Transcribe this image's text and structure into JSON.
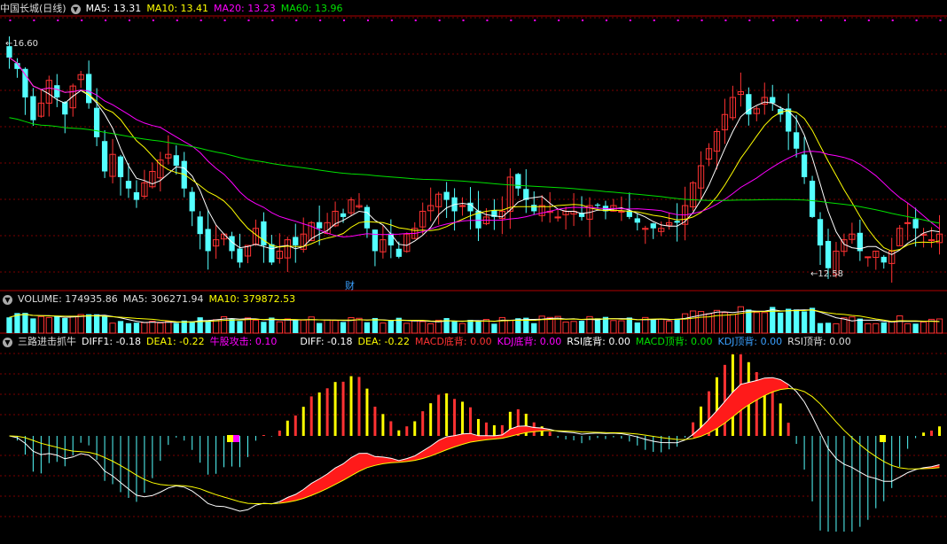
{
  "main_header": {
    "stock": "中国长城(日线)",
    "ma5": "MA5: 13.31",
    "ma10": "MA10: 13.41",
    "ma20": "MA20: 13.23",
    "ma60": "MA60: 13.96"
  },
  "price_labels": {
    "high": "16.60",
    "low": "12.58",
    "event": "财"
  },
  "volume_header": {
    "volume": "VOLUME: 174935.86",
    "ma5": "MA5: 306271.94",
    "ma10": "MA10: 379872.53"
  },
  "indicator_header": {
    "name": "三路进击抓牛",
    "diff1": "DIFF1: -0.18",
    "dea1": "DEA1: -0.22",
    "niu": "牛股攻击: 0.10",
    "diff": "DIFF: -0.18",
    "dea": "DEA: -0.22",
    "macd_bottom": "MACD底背: 0.00",
    "kdj_bottom": "KDJ底背: 0.00",
    "rsi_bottom": "RSI底背: 0.00",
    "macd_top": "MACD顶背: 0.00",
    "kdj_top": "KDJ顶背: 0.00",
    "rsi_top": "RSI顶背: 0.00"
  },
  "colors": {
    "up": "#ff3232",
    "down": "#54ffff",
    "ma5": "#ffffff",
    "ma10": "#ffff00",
    "ma20": "#ff00ff",
    "ma60": "#00e000",
    "grid": "#7a0000",
    "divider": "#b00000"
  },
  "chart_data": {
    "type": "candlestick",
    "price_range": [
      12.3,
      17.0
    ],
    "closes": [
      16.3,
      16.1,
      15.6,
      15.2,
      15.5,
      15.9,
      15.6,
      15.3,
      15.8,
      16.0,
      15.5,
      14.9,
      14.3,
      14.6,
      14.2,
      14.0,
      13.8,
      14.1,
      14.3,
      14.5,
      14.6,
      14.4,
      14.0,
      13.6,
      13.2,
      12.9,
      13.1,
      13.2,
      12.9,
      12.7,
      13.0,
      13.3,
      13.0,
      12.7,
      12.9,
      13.1,
      13.0,
      13.2,
      13.4,
      13.3,
      13.4,
      13.6,
      13.5,
      13.8,
      13.7,
      13.3,
      12.9,
      13.1,
      13.0,
      12.8,
      13.2,
      13.3,
      13.6,
      13.7,
      13.9,
      13.8,
      13.6,
      13.7,
      13.6,
      13.3,
      13.5,
      13.5,
      13.6,
      14.2,
      14.0,
      13.8,
      13.6,
      13.7,
      13.6,
      13.5,
      13.6,
      13.6,
      13.5,
      13.7,
      13.7,
      13.6,
      13.7,
      13.6,
      13.5,
      13.4,
      13.3,
      13.3,
      13.3,
      13.4,
      13.4,
      13.7,
      14.1,
      14.4,
      14.7,
      15.0,
      15.3,
      15.6,
      15.7,
      15.3,
      15.4,
      15.6,
      15.5,
      15.3,
      15.0,
      14.7,
      14.2,
      13.5,
      13.0,
      12.6,
      12.9,
      13.1,
      13.2,
      12.9,
      12.8,
      12.9,
      12.7,
      12.9,
      13.3,
      13.4,
      13.3,
      13.2,
      13.1,
      13.2
    ],
    "volume_range": [
      0,
      1000000
    ]
  }
}
